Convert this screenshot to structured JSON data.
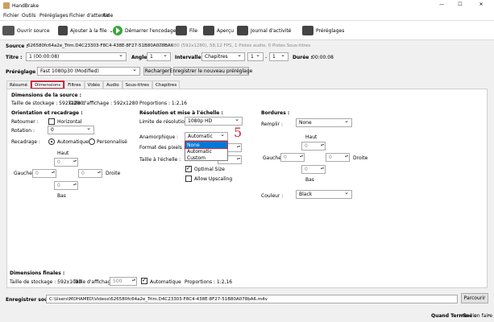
{
  "window": {
    "title": "HandBrake"
  },
  "menu": [
    "Fichier",
    "Outils",
    "Préréglages",
    "Fichier d'attente",
    "Aide"
  ],
  "toolbar": {
    "open_source": "Ouvrir source",
    "add_queue": "Ajouter à la file",
    "start": "Démarrer l'encodage",
    "queue": "File",
    "preview": "Aperçu",
    "activity": "Journal d'activité",
    "presets": "Préréglages"
  },
  "source": {
    "label": "Source :",
    "name": "626580fc64a2e_Trim.D4C23303-F8C4-438E-8F27-51B80A078BA6",
    "info": "592x1280 (592x1280), 58,12 FPS, 1 Pistes audio, 0 Pistes Sous-titres"
  },
  "title_row": {
    "label": "Titre :",
    "value": "1 (00:00:08)",
    "angle_label": "Angle :",
    "angle_value": "1",
    "interval_label": "Intervalle :",
    "interval_value": "Chapitres",
    "from": "1",
    "dash": "-",
    "to": "1",
    "duration_label": "Durée :",
    "duration_value": "00:00:08"
  },
  "preset_row": {
    "label": "Préréglage :",
    "value": "Fast 1080p30 (Modified)",
    "reload": "Recharger",
    "save_new": "Enregistrer le nouveau préréglage"
  },
  "tabs": [
    "Résumé",
    "Dimensions",
    "Filtres",
    "Vidéo",
    "Audio",
    "Sous-titres",
    "Chapitres"
  ],
  "source_dims": {
    "title": "Dimensions de la source :",
    "storage": "Taille de stockage : 592x1280",
    "display": "Taille d'affichage : 592x1280",
    "ratio": "Proportions : 1:2,16"
  },
  "orientation": {
    "title": "Orientation et recadrage :",
    "flip_label": "Retourner :",
    "flip_value": "Horizontal",
    "rotation_label": "Rotation :",
    "rotation_value": "0",
    "crop_label": "Recadrage :",
    "crop_auto": "Automatique",
    "crop_custom": "Personnalisé",
    "top": "Haut",
    "left": "Gauche",
    "right": "Droite",
    "bottom": "Bas",
    "v_top": "0",
    "v_left": "0",
    "v_right": "0",
    "v_bottom": "0"
  },
  "resolution": {
    "title": "Résolution et mise à l'échelle :",
    "limit_label": "Limite de résolution :",
    "limit_value": "1080p HD",
    "anamorphic_label": "Anamorphique :",
    "anamorphic_value": "Automatic",
    "anamorphic_options": [
      "None",
      "Automatic",
      "Custom"
    ],
    "pixel_format_label": "Format des pixels :",
    "scale_label": "Taille à l'échelle :",
    "optimal": "Optimal Size",
    "upscaling": "Allow Upscaling",
    "annotation": "5"
  },
  "borders": {
    "title": "Bordures :",
    "fill_label": "Remplir :",
    "fill_value": "None",
    "top": "Haut",
    "left": "Gauche",
    "right": "Droite",
    "bottom": "Bas",
    "v_top": "0",
    "v_left": "0",
    "v_right": "0",
    "v_bottom": "0",
    "color_label": "Couleur :",
    "color_value": "Black"
  },
  "final_dims": {
    "title": "Dimensions finales :",
    "storage": "Taille de stockage : 592x1080",
    "display_label": "Taille d'affichage :",
    "display_value": "500",
    "auto": "Automatique",
    "ratio": "Proportions : 1:2,16"
  },
  "save": {
    "label": "Enregistrer sous :",
    "path": "C:\\Users\\MOHAMED\\Videos\\626580fc64a2e_Trim.D4C23303-F8C4-438E-8F27-51B80A078bA6.m4v",
    "browse": "Parcourir"
  },
  "status": {
    "label": "Quand Terminé :",
    "value": "Ne rien faire"
  },
  "colors": {
    "highlight": "#d1283d",
    "selection": "#0078d7"
  }
}
